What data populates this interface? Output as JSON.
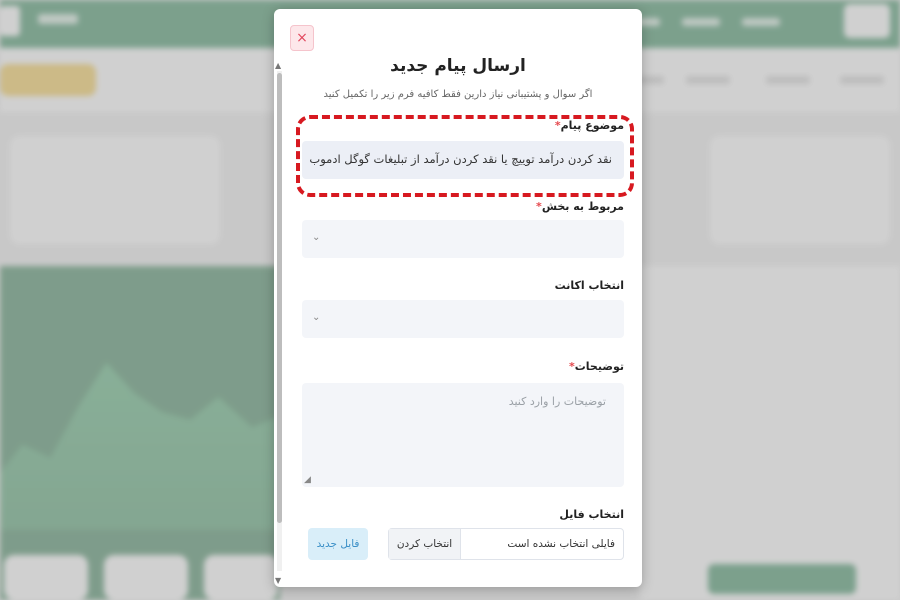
{
  "modal": {
    "title": "ارسال پیام جدید",
    "subtitle": "اگر سوال و پشتیبانی نیاز دارین فقط کافیه فرم زیر را تکمیل کنید",
    "close_icon": "×",
    "required_mark": "*",
    "subject": {
      "label": "موضوع پیام",
      "value": "نقد کردن درآمد توییچ یا نقد کردن درآمد از تبلیغات گوگل ادموب"
    },
    "section": {
      "label": "مربوط به بخش",
      "value": ""
    },
    "account": {
      "label": "انتخاب اکانت",
      "value": ""
    },
    "description": {
      "label": "توضیحات",
      "placeholder": "توضیحات را وارد کنید"
    },
    "file": {
      "label": "انتخاب فایل",
      "choose_label": "انتخاب کردن",
      "status": "فایلی انتخاب نشده است",
      "new_file_label": "فایل جدید"
    }
  },
  "colors": {
    "brand_green": "#157a43",
    "highlight_red": "#d71920",
    "required_red": "#e5484d",
    "button_blue": "#3a8fc7"
  }
}
